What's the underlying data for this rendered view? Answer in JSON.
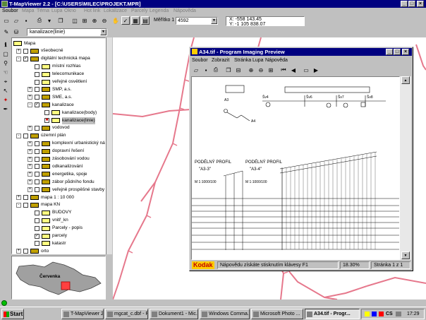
{
  "window": {
    "title": "T-MapViewer 2.2 - [C:\\USERS\\MILEC\\PROJEKT.MPR]"
  },
  "menu": [
    {
      "label": "Soubor",
      "enabled": true
    },
    {
      "label": "Mapa",
      "enabled": false
    },
    {
      "label": "Téma",
      "enabled": false
    },
    {
      "label": "Lupa",
      "enabled": false
    },
    {
      "label": "Okno",
      "enabled": false
    },
    {
      "label": "Hot link",
      "enabled": false
    },
    {
      "label": "Lokalizace",
      "enabled": false
    },
    {
      "label": "Parcely",
      "enabled": false
    },
    {
      "label": "Legenda",
      "enabled": false
    },
    {
      "label": "Nápověda",
      "enabled": false
    }
  ],
  "toolbar": {
    "scale_label": "Měřítko 1 :",
    "scale_value": "4592",
    "coord_x": "X: -558 143.45",
    "coord_y": "Y: -1 105 838.07"
  },
  "layer_select": {
    "value": "kanalizace(linie)"
  },
  "tree": [
    {
      "label": "Mapa",
      "icon": "map-icon",
      "exp": "",
      "chk": "",
      "selected": false
    },
    {
      "label": "všeobecné",
      "icon": "folder-icon",
      "exp": "+",
      "chk": "",
      "selected": false
    },
    {
      "label": "digitální technická mapa",
      "icon": "folder-icon",
      "exp": "-",
      "chk": "✓",
      "selected": false
    },
    {
      "label": "místní rozhlas",
      "icon": "layer-icon",
      "exp": "",
      "chk": "",
      "selected": false
    },
    {
      "label": "telecomunikace",
      "icon": "layer-icon",
      "exp": "",
      "chk": "",
      "selected": false
    },
    {
      "label": "veřejné osvětlení",
      "icon": "layer-icon",
      "exp": "",
      "chk": "",
      "selected": false
    },
    {
      "label": "SMP, a.s.",
      "icon": "folder-icon",
      "exp": "+",
      "chk": "",
      "selected": false
    },
    {
      "label": "SME, a.s.",
      "icon": "folder-icon",
      "exp": "+",
      "chk": "",
      "selected": false
    },
    {
      "label": "kanalizace",
      "icon": "folder-icon",
      "exp": "-",
      "chk": "✓",
      "selected": false
    },
    {
      "label": "kanalizace(body)",
      "icon": "layer-icon",
      "exp": "",
      "chk": "",
      "selected": false
    },
    {
      "label": "kanalizace(linie)",
      "icon": "layer-icon",
      "exp": "",
      "chk": "■",
      "selected": true
    },
    {
      "label": "vodovod",
      "icon": "folder-icon",
      "exp": "+",
      "chk": "",
      "selected": false
    },
    {
      "label": "územní plán",
      "icon": "folder-icon",
      "exp": "-",
      "chk": "",
      "selected": false
    },
    {
      "label": "komplexní urbanistický návrh",
      "icon": "folder-icon",
      "exp": "+",
      "chk": "",
      "selected": false
    },
    {
      "label": "dopravní řešení",
      "icon": "folder-icon",
      "exp": "+",
      "chk": "",
      "selected": false
    },
    {
      "label": "zásobování vodou",
      "icon": "folder-icon",
      "exp": "+",
      "chk": "",
      "selected": false
    },
    {
      "label": "odkanalizování",
      "icon": "folder-icon",
      "exp": "+",
      "chk": "",
      "selected": false
    },
    {
      "label": "energetika, spoje",
      "icon": "folder-icon",
      "exp": "+",
      "chk": "",
      "selected": false
    },
    {
      "label": "zábor půdního fondu",
      "icon": "folder-icon",
      "exp": "+",
      "chk": "",
      "selected": false
    },
    {
      "label": "veřejně prospěšné stavby",
      "icon": "folder-icon",
      "exp": "+",
      "chk": "",
      "selected": false
    },
    {
      "label": "mapa 1 : 10 000",
      "icon": "folder-icon",
      "exp": "+",
      "chk": "",
      "selected": false
    },
    {
      "label": "mapa KN",
      "icon": "folder-icon",
      "exp": "-",
      "chk": "",
      "selected": false
    },
    {
      "label": "BUDOVY",
      "icon": "layer-icon",
      "exp": "",
      "chk": "",
      "selected": false
    },
    {
      "label": "vnitř_kn",
      "icon": "layer-icon",
      "exp": "",
      "chk": "",
      "selected": false
    },
    {
      "label": "Parcely - popis",
      "icon": "layer-icon",
      "exp": "",
      "chk": "",
      "selected": false
    },
    {
      "label": "parcely",
      "icon": "layer-icon",
      "exp": "",
      "chk": "✓",
      "selected": false
    },
    {
      "label": "katastr",
      "icon": "layer-icon",
      "exp": "",
      "chk": "",
      "selected": false
    },
    {
      "label": "orto",
      "icon": "folder-icon",
      "exp": "+",
      "chk": "",
      "selected": false
    }
  ],
  "overview": {
    "label": "Červenka"
  },
  "preview": {
    "title": "A34.tif - Program Imaging Preview",
    "menu": [
      "Soubor",
      "Zobrazit",
      "Stránka",
      "Lupa",
      "Nápověda"
    ],
    "doc": {
      "profile_left": "PODÉLNÝ PROFIL",
      "profile_left_id": "\"A3-3\"",
      "profile_right": "PODÉLNÝ PROFIL",
      "profile_right_id": "\"A3-4\"",
      "scale_left": "M 1:1000/100",
      "scale_right": "M 1:1000/100",
      "node_labels": [
        "Šv4",
        "Šv6",
        "Šv7",
        "Šv8"
      ],
      "node_a3": "A3",
      "node_a4": "A4"
    },
    "status": {
      "logo": "Kodak",
      "hint": "Nápovědu získáte stisknutím klávesy F1",
      "zoom": "18.30%",
      "page": "Stránka 1 z 1"
    }
  },
  "taskbar": {
    "start": "Start",
    "tasks": [
      {
        "label": "T-MapViewer 2.2",
        "active": false
      },
      {
        "label": "mgcat_c.dbf - Po...",
        "active": false
      },
      {
        "label": "Dokument1 - Mic...",
        "active": false
      },
      {
        "label": "Windows Comma...",
        "active": false
      },
      {
        "label": "Microsoft Photo ...",
        "active": false
      },
      {
        "label": "A34.tif - Progr...",
        "active": true
      }
    ],
    "tray_lang": "CS",
    "clock": "17:29"
  },
  "colors": {
    "titlebar": "#000080",
    "map_lines": "#e6788c",
    "desktop": "#c0c0c0"
  }
}
